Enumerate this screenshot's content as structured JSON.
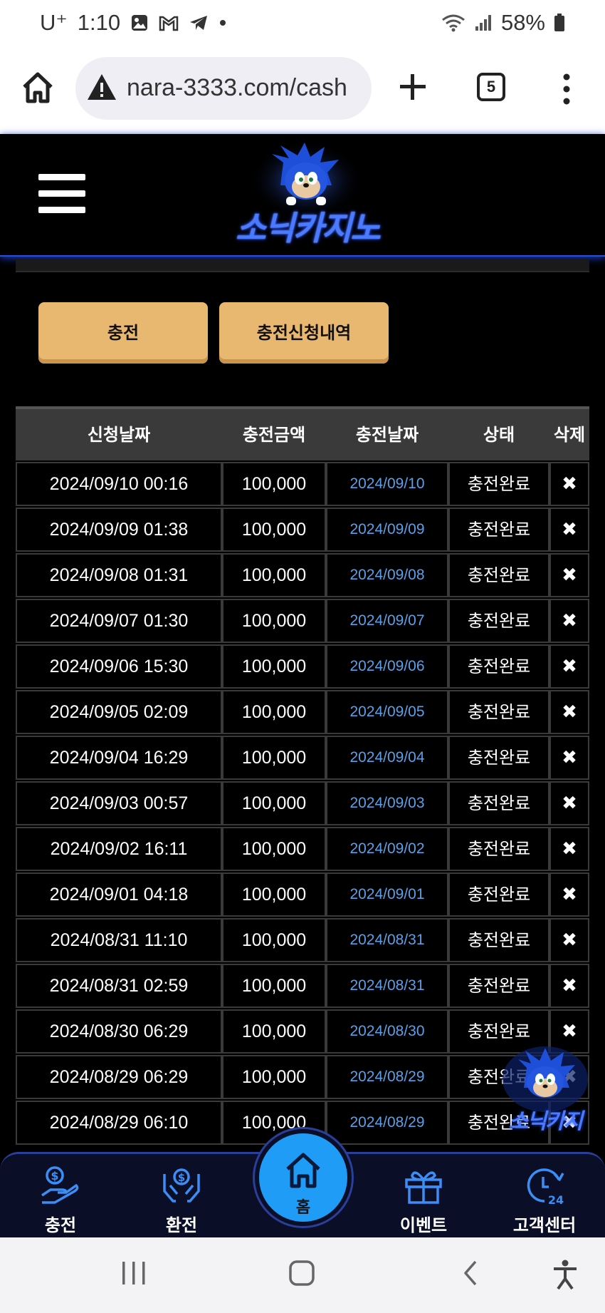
{
  "status_bar": {
    "carrier": "U⁺",
    "time": "1:10",
    "battery": "58%"
  },
  "browser": {
    "url": "nara-3333.com/cash",
    "tab_count": "5"
  },
  "site": {
    "logo_text": "소닉카지노"
  },
  "actions": {
    "charge_label": "충전",
    "history_label": "충전신청내역"
  },
  "table": {
    "headers": [
      "신청날짜",
      "충전금액",
      "충전날짜",
      "상태",
      "삭제"
    ],
    "rows": [
      {
        "requested": "2024/09/10 00:16",
        "amount": "100,000",
        "charged": "2024/09/10",
        "status": "충전완료",
        "delete": "✖"
      },
      {
        "requested": "2024/09/09 01:38",
        "amount": "100,000",
        "charged": "2024/09/09",
        "status": "충전완료",
        "delete": "✖"
      },
      {
        "requested": "2024/09/08 01:31",
        "amount": "100,000",
        "charged": "2024/09/08",
        "status": "충전완료",
        "delete": "✖"
      },
      {
        "requested": "2024/09/07 01:30",
        "amount": "100,000",
        "charged": "2024/09/07",
        "status": "충전완료",
        "delete": "✖"
      },
      {
        "requested": "2024/09/06 15:30",
        "amount": "100,000",
        "charged": "2024/09/06",
        "status": "충전완료",
        "delete": "✖"
      },
      {
        "requested": "2024/09/05 02:09",
        "amount": "100,000",
        "charged": "2024/09/05",
        "status": "충전완료",
        "delete": "✖"
      },
      {
        "requested": "2024/09/04 16:29",
        "amount": "100,000",
        "charged": "2024/09/04",
        "status": "충전완료",
        "delete": "✖"
      },
      {
        "requested": "2024/09/03 00:57",
        "amount": "100,000",
        "charged": "2024/09/03",
        "status": "충전완료",
        "delete": "✖"
      },
      {
        "requested": "2024/09/02 16:11",
        "amount": "100,000",
        "charged": "2024/09/02",
        "status": "충전완료",
        "delete": "✖"
      },
      {
        "requested": "2024/09/01 04:18",
        "amount": "100,000",
        "charged": "2024/09/01",
        "status": "충전완료",
        "delete": "✖"
      },
      {
        "requested": "2024/08/31 11:10",
        "amount": "100,000",
        "charged": "2024/08/31",
        "status": "충전완료",
        "delete": "✖"
      },
      {
        "requested": "2024/08/31 02:59",
        "amount": "100,000",
        "charged": "2024/08/31",
        "status": "충전완료",
        "delete": "✖"
      },
      {
        "requested": "2024/08/30 06:29",
        "amount": "100,000",
        "charged": "2024/08/30",
        "status": "충전완료",
        "delete": "✖"
      },
      {
        "requested": "2024/08/29 06:29",
        "amount": "100,000",
        "charged": "2024/08/29",
        "status": "충전완료",
        "delete": "✖"
      },
      {
        "requested": "2024/08/29 06:10",
        "amount": "100,000",
        "charged": "2024/08/29",
        "status": "충전완료",
        "delete": "✖"
      }
    ]
  },
  "bottom_nav": {
    "charge": "충전",
    "exchange": "환전",
    "home": "홈",
    "event": "이벤트",
    "support": "고객센터"
  },
  "floating_badge": {
    "text": "소닉카지"
  },
  "colors": {
    "button_gold": "#e8b871",
    "date_blue": "#5aa0e8",
    "accent_blue": "#1f9cf5",
    "header_border": "#2a4ed8"
  }
}
